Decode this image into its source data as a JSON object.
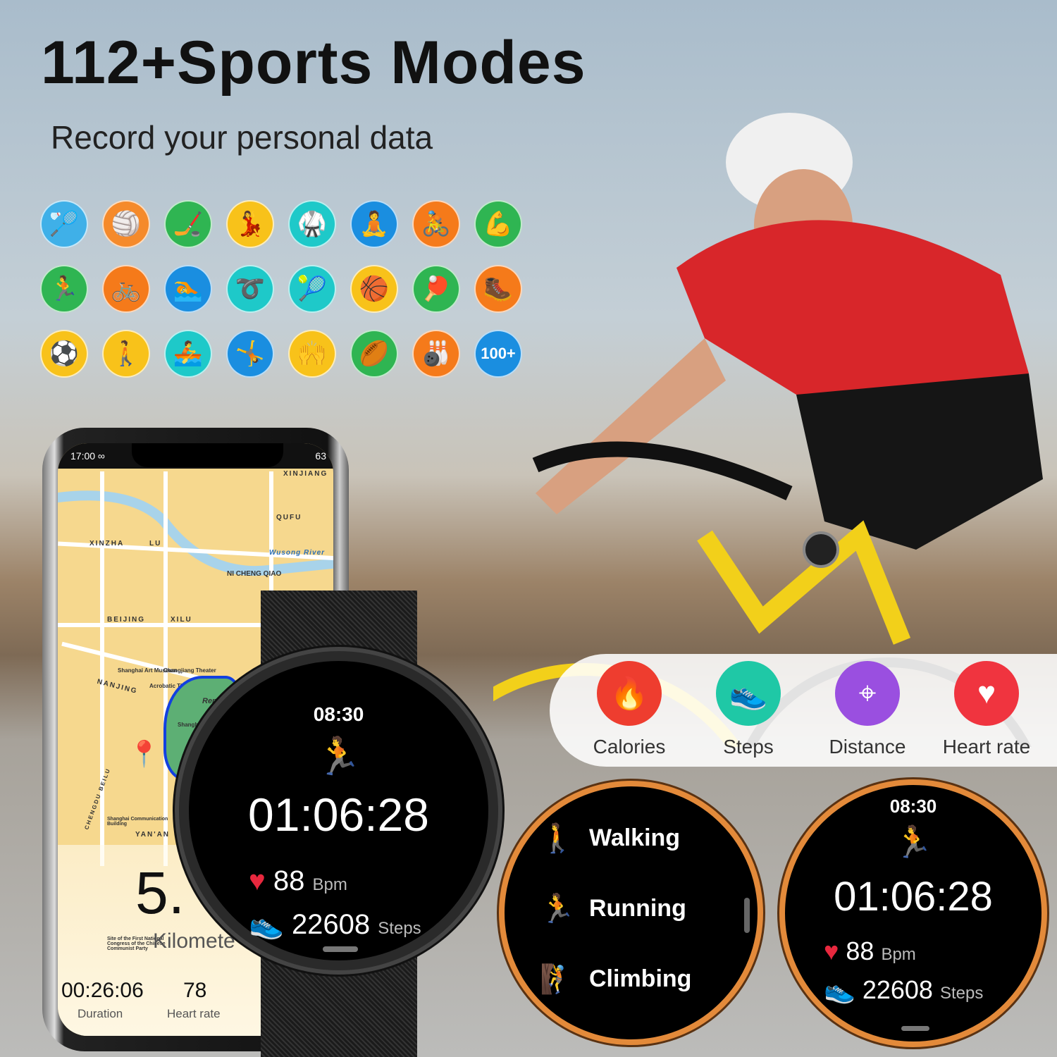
{
  "headline": {
    "title": "112+Sports Modes",
    "subtitle": "Record your personal data"
  },
  "sport_icons": [
    {
      "icon": "badminton-icon",
      "color": "#3fb0e8"
    },
    {
      "icon": "volleyball-icon",
      "color": "#f58a2b"
    },
    {
      "icon": "hockey-icon",
      "color": "#2fb552"
    },
    {
      "icon": "dance-icon",
      "color": "#f8c21a"
    },
    {
      "icon": "taekwondo-icon",
      "color": "#1ec9c9"
    },
    {
      "icon": "yoga-icon",
      "color": "#1a8ee0"
    },
    {
      "icon": "spinning-bike-icon",
      "color": "#f57a1a"
    },
    {
      "icon": "situp-icon",
      "color": "#2fb552"
    },
    {
      "icon": "running-icon",
      "color": "#2fb552"
    },
    {
      "icon": "cycling-icon",
      "color": "#f57a1a"
    },
    {
      "icon": "swimming-icon",
      "color": "#1a8ee0"
    },
    {
      "icon": "jump-rope-icon",
      "color": "#1ec9c9"
    },
    {
      "icon": "tennis-icon",
      "color": "#1ec9c9"
    },
    {
      "icon": "basketball-icon",
      "color": "#f8c21a"
    },
    {
      "icon": "table-tennis-icon",
      "color": "#2fb552"
    },
    {
      "icon": "hiking-icon",
      "color": "#f57a1a"
    },
    {
      "icon": "football-icon",
      "color": "#f8c21a"
    },
    {
      "icon": "walking-icon",
      "color": "#f8c21a"
    },
    {
      "icon": "rowing-icon",
      "color": "#1ec9c9"
    },
    {
      "icon": "gymnastics-icon",
      "color": "#1a8ee0"
    },
    {
      "icon": "jumping-jacks-icon",
      "color": "#f8c21a"
    },
    {
      "icon": "rugby-icon",
      "color": "#2fb552"
    },
    {
      "icon": "bowling-icon",
      "color": "#f57a1a"
    },
    {
      "icon": "more-icon",
      "color": "#1a8ee0",
      "label": "100+"
    }
  ],
  "phone": {
    "status_time": "17:00 ∞",
    "battery": "63",
    "map_labels": [
      "XINZHA",
      "LU",
      "BEIJING",
      "XILU",
      "NANJING",
      "NI CHENG QIAO",
      "QUFU",
      "XINJIANG",
      "Wusong River",
      "Shanghai Art Museum",
      "Changjiang Theater",
      "Acrobatic Theater",
      "Shanghai Library",
      "Renmin (People's)",
      "YAN'AN",
      "CHENGDU BEILU",
      "Shanghai Communication Building",
      "Site of the First National Congress of the Chinese Communist Party"
    ],
    "distance": "5.",
    "distance_unit": "Kilomete",
    "duration": "00:26:06",
    "duration_label": "Duration",
    "heart_rate": "78",
    "heart_rate_label": "Heart rate"
  },
  "watch_main": {
    "clock": "08:30",
    "timer": "01:06:28",
    "bpm": "88",
    "bpm_unit": "Bpm",
    "steps": "22608",
    "steps_unit": "Steps"
  },
  "features": [
    {
      "label": "Calories",
      "icon": "flame-icon",
      "color": "#ee3d2f"
    },
    {
      "label": "Steps",
      "icon": "shoe-icon",
      "color": "#1fc8a6"
    },
    {
      "label": "Distance",
      "icon": "location-pin-icon",
      "color": "#9a4fe0"
    },
    {
      "label": "Heart rate",
      "icon": "heart-icon",
      "color": "#f0343f"
    }
  ],
  "watch_menu": {
    "items": [
      {
        "label": "Walking",
        "color": "#2fc25b"
      },
      {
        "label": "Running",
        "color": "#f07a1b"
      },
      {
        "label": "Climbing",
        "color": "#e8283e"
      }
    ]
  },
  "watch_right": {
    "clock": "08:30",
    "timer": "01:06:28",
    "bpm": "88",
    "bpm_unit": "Bpm",
    "steps": "22608",
    "steps_unit": "Steps"
  }
}
